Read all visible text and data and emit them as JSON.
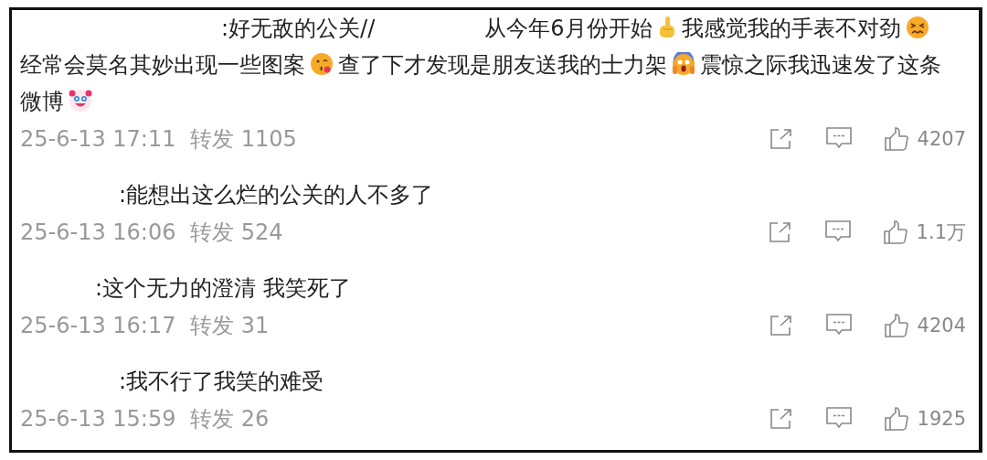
{
  "comments": [
    {
      "parts": [
        [
          {
            "kind": "text",
            "text": ":好无敌的公关//"
          }
        ],
        [
          {
            "kind": "text",
            "text": "从今年6月份开始"
          },
          {
            "kind": "pointing"
          },
          {
            "kind": "text",
            "text": "我感觉我的手表不对劲"
          },
          {
            "kind": "grimace"
          },
          {
            "kind": "text",
            "text": "经常会莫名其妙出现一些图案"
          },
          {
            "kind": "kiss"
          },
          {
            "kind": "text",
            "text": "查了下才发现是朋友送我的士力架"
          },
          {
            "kind": "scream"
          },
          {
            "kind": "text",
            "text": "震惊之际我迅速发了这条"
          },
          {
            "kind": "text",
            "text": "微博"
          },
          {
            "kind": "clown"
          }
        ]
      ],
      "time": "25-6-13 17:11",
      "reposts": "转发 1105",
      "likes": "4207"
    },
    {
      "parts": [
        [
          {
            "kind": "text",
            "text": ":能想出这么烂的公关的人不多了"
          }
        ]
      ],
      "time": "25-6-13 16:06",
      "reposts": "转发 524",
      "likes": "1.1万"
    },
    {
      "parts": [
        [
          {
            "kind": "text",
            "text": ":这个无力的澄清 我笑死了"
          }
        ]
      ],
      "time": "25-6-13 16:17",
      "reposts": "转发 31",
      "likes": "4204"
    },
    {
      "parts": [
        [
          {
            "kind": "text",
            "text": ":我不行了我笑的难受"
          }
        ]
      ],
      "time": "25-6-13 15:59",
      "reposts": "转发 26",
      "likes": "1925"
    }
  ]
}
